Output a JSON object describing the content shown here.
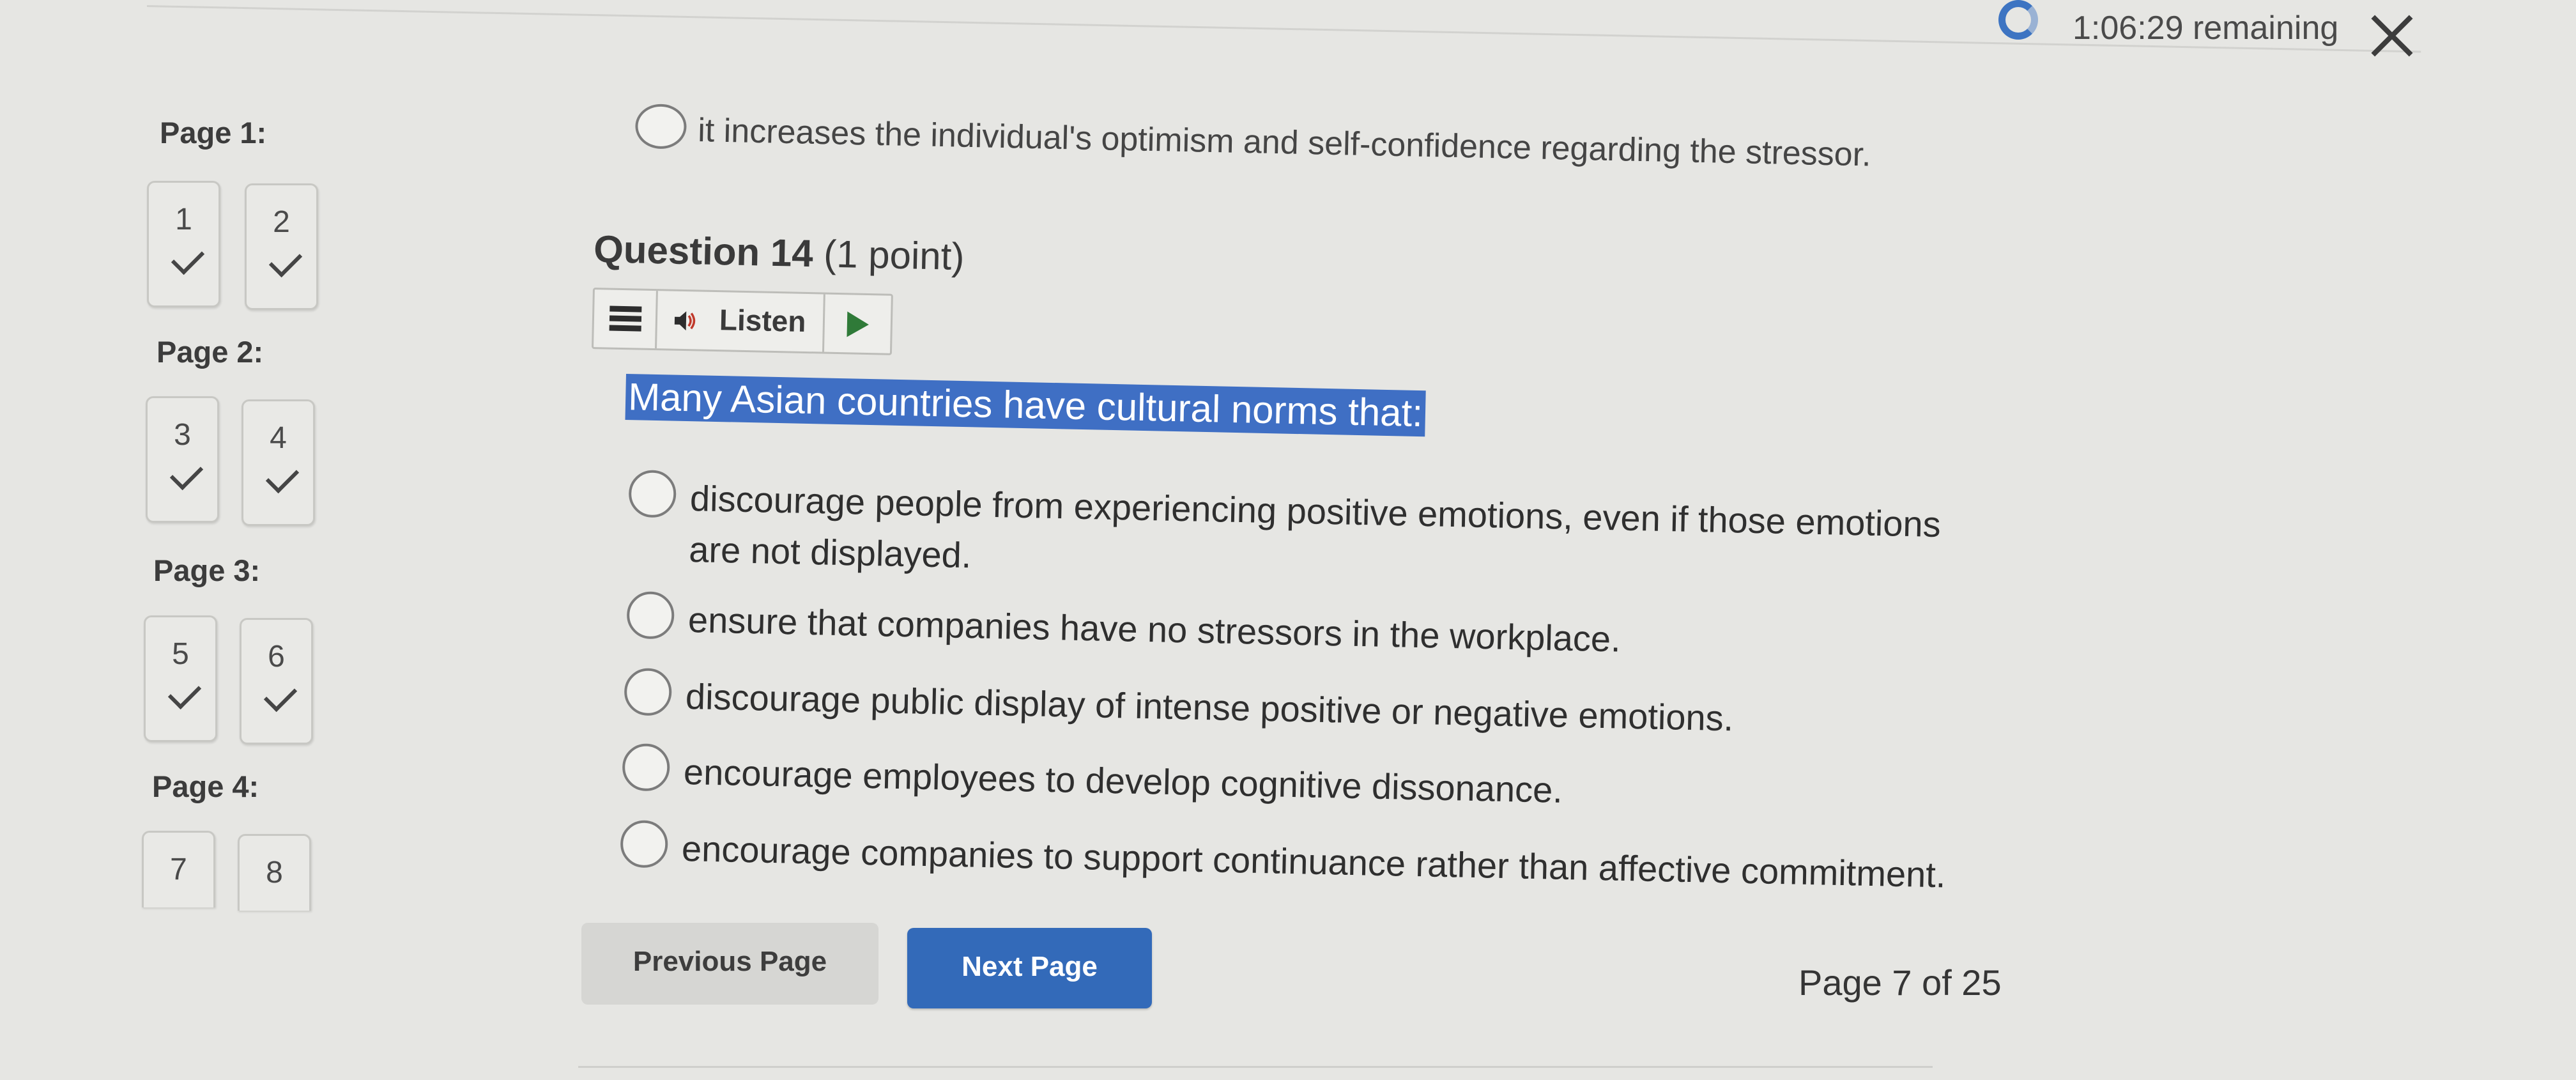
{
  "timer": {
    "text": "1:06:29 remaining",
    "icon": "timer-ring-icon"
  },
  "close": {
    "icon": "close-icon"
  },
  "nav": {
    "pages": [
      {
        "label": "Page 1:",
        "questions": [
          {
            "num": "1",
            "answered": true
          },
          {
            "num": "2",
            "answered": true
          }
        ]
      },
      {
        "label": "Page 2:",
        "questions": [
          {
            "num": "3",
            "answered": true
          },
          {
            "num": "4",
            "answered": true
          }
        ]
      },
      {
        "label": "Page 3:",
        "questions": [
          {
            "num": "5",
            "answered": true
          },
          {
            "num": "6",
            "answered": true
          }
        ]
      },
      {
        "label": "Page 4:",
        "questions": [
          {
            "num": "7",
            "answered": false
          },
          {
            "num": "8",
            "answered": false
          }
        ]
      }
    ]
  },
  "previous_question": {
    "last_option": "it increases the individual's optimism and self-confidence regarding the stressor."
  },
  "question": {
    "title": "Question 14",
    "points": "(1 point)",
    "listen": {
      "label": "Listen",
      "menu_icon": "menu-icon",
      "speaker_icon": "speaker-icon",
      "play_icon": "play-icon"
    },
    "stem": "Many Asian countries have cultural norms that:",
    "options": [
      "discourage people from experiencing positive emotions, even if those emotions",
      "are not displayed.",
      "ensure that companies have no stressors in the workplace.",
      "discourage public display of intense positive or negative emotions.",
      "encourage employees to develop cognitive dissonance.",
      "encourage companies to support continuance rather than affective commitment."
    ]
  },
  "footer": {
    "previous_label": "Previous Page",
    "next_label": "Next Page",
    "page_count": "Page 7 of 25"
  },
  "colors": {
    "accent": "#336ab9",
    "highlight": "#3f6fc4",
    "background": "#e6e6e3"
  }
}
